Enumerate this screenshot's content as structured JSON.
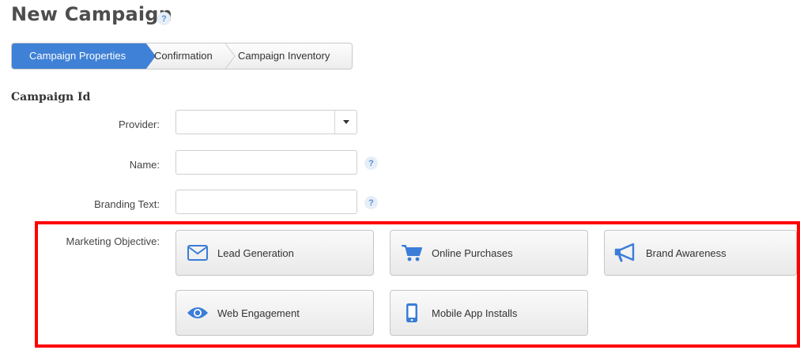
{
  "page": {
    "title": "New Campaign",
    "help": "?"
  },
  "wizard": {
    "steps": [
      {
        "label": "Campaign Properties",
        "active": true
      },
      {
        "label": "Confirmation",
        "active": false
      },
      {
        "label": "Campaign Inventory",
        "active": false
      }
    ]
  },
  "section": {
    "title": "Campaign Id"
  },
  "form": {
    "provider": {
      "label": "Provider:",
      "value": ""
    },
    "name": {
      "label": "Name:",
      "value": "",
      "help": "?"
    },
    "branding": {
      "label": "Branding Text:",
      "value": "",
      "help": "?"
    },
    "objective": {
      "label": "Marketing Objective:",
      "options": [
        {
          "label": "Lead Generation",
          "icon": "envelope-icon"
        },
        {
          "label": "Online Purchases",
          "icon": "shopping-cart-icon"
        },
        {
          "label": "Brand Awareness",
          "icon": "megaphone-icon"
        },
        {
          "label": "Web Engagement",
          "icon": "eye-icon"
        },
        {
          "label": "Mobile App Installs",
          "icon": "mobile-phone-icon"
        }
      ]
    }
  },
  "colors": {
    "accent": "#3f81d6",
    "highlight": "#ff0000",
    "icon": "#3b7dd8"
  }
}
